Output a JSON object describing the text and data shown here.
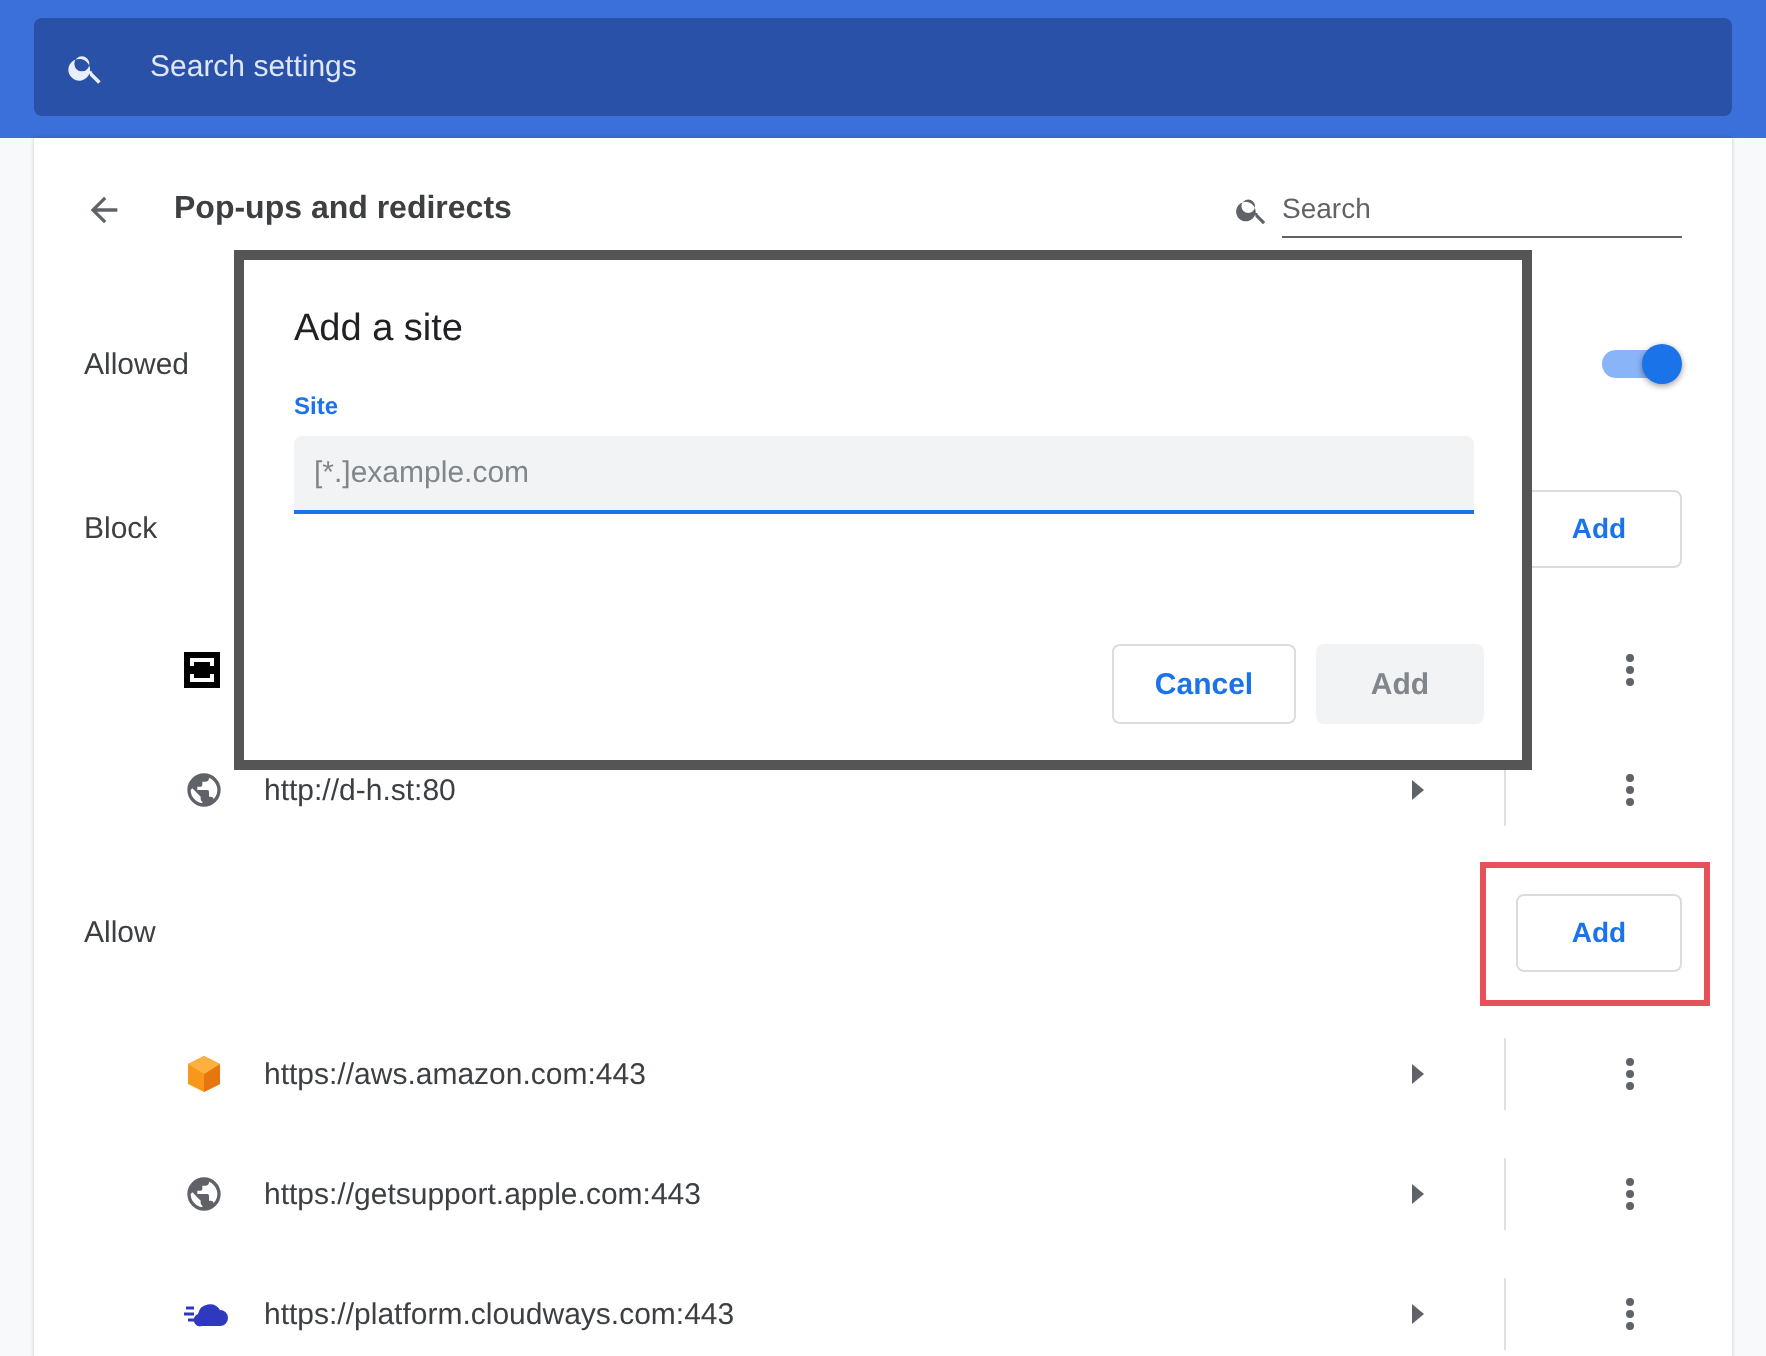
{
  "search_bar": {
    "placeholder": "Search settings"
  },
  "header": {
    "title": "Pop-ups and redirects",
    "search": {
      "placeholder": "Search"
    }
  },
  "allowed_setting": {
    "label": "Allowed",
    "on": true
  },
  "sections": [
    {
      "title": "Block",
      "add_button": "Add",
      "highlighted": false,
      "sites": [
        {
          "kind": "frame"
        },
        {
          "kind": "globe",
          "url": "http://d-h.st:80"
        }
      ]
    },
    {
      "title": "Allow",
      "add_button": "Add",
      "highlighted": true,
      "sites": [
        {
          "kind": "box",
          "url": "https://aws.amazon.com:443"
        },
        {
          "kind": "globe",
          "url": "https://getsupport.apple.com:443"
        },
        {
          "kind": "cloud",
          "url": "https://platform.cloudways.com:443"
        }
      ]
    }
  ],
  "dialog": {
    "title": "Add a site",
    "field_label": "Site",
    "placeholder": "[*.]example.com",
    "buttons": [
      {
        "label": "Cancel",
        "disabled": false
      },
      {
        "label": "Add",
        "disabled": true
      }
    ]
  }
}
